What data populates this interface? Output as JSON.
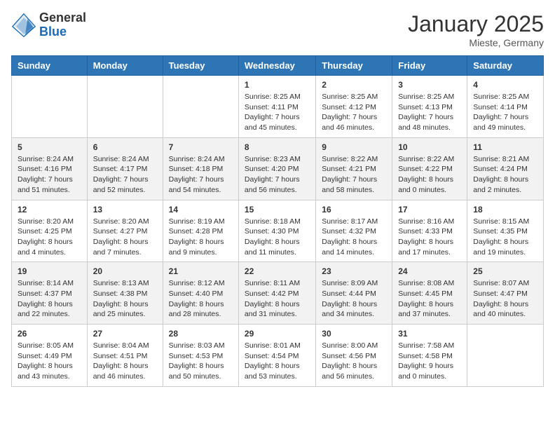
{
  "header": {
    "logo_general": "General",
    "logo_blue": "Blue",
    "month_title": "January 2025",
    "location": "Mieste, Germany"
  },
  "weekdays": [
    "Sunday",
    "Monday",
    "Tuesday",
    "Wednesday",
    "Thursday",
    "Friday",
    "Saturday"
  ],
  "weeks": [
    [
      {
        "day": "",
        "info": ""
      },
      {
        "day": "",
        "info": ""
      },
      {
        "day": "",
        "info": ""
      },
      {
        "day": "1",
        "info": "Sunrise: 8:25 AM\nSunset: 4:11 PM\nDaylight: 7 hours\nand 45 minutes."
      },
      {
        "day": "2",
        "info": "Sunrise: 8:25 AM\nSunset: 4:12 PM\nDaylight: 7 hours\nand 46 minutes."
      },
      {
        "day": "3",
        "info": "Sunrise: 8:25 AM\nSunset: 4:13 PM\nDaylight: 7 hours\nand 48 minutes."
      },
      {
        "day": "4",
        "info": "Sunrise: 8:25 AM\nSunset: 4:14 PM\nDaylight: 7 hours\nand 49 minutes."
      }
    ],
    [
      {
        "day": "5",
        "info": "Sunrise: 8:24 AM\nSunset: 4:16 PM\nDaylight: 7 hours\nand 51 minutes."
      },
      {
        "day": "6",
        "info": "Sunrise: 8:24 AM\nSunset: 4:17 PM\nDaylight: 7 hours\nand 52 minutes."
      },
      {
        "day": "7",
        "info": "Sunrise: 8:24 AM\nSunset: 4:18 PM\nDaylight: 7 hours\nand 54 minutes."
      },
      {
        "day": "8",
        "info": "Sunrise: 8:23 AM\nSunset: 4:20 PM\nDaylight: 7 hours\nand 56 minutes."
      },
      {
        "day": "9",
        "info": "Sunrise: 8:22 AM\nSunset: 4:21 PM\nDaylight: 7 hours\nand 58 minutes."
      },
      {
        "day": "10",
        "info": "Sunrise: 8:22 AM\nSunset: 4:22 PM\nDaylight: 8 hours\nand 0 minutes."
      },
      {
        "day": "11",
        "info": "Sunrise: 8:21 AM\nSunset: 4:24 PM\nDaylight: 8 hours\nand 2 minutes."
      }
    ],
    [
      {
        "day": "12",
        "info": "Sunrise: 8:20 AM\nSunset: 4:25 PM\nDaylight: 8 hours\nand 4 minutes."
      },
      {
        "day": "13",
        "info": "Sunrise: 8:20 AM\nSunset: 4:27 PM\nDaylight: 8 hours\nand 7 minutes."
      },
      {
        "day": "14",
        "info": "Sunrise: 8:19 AM\nSunset: 4:28 PM\nDaylight: 8 hours\nand 9 minutes."
      },
      {
        "day": "15",
        "info": "Sunrise: 8:18 AM\nSunset: 4:30 PM\nDaylight: 8 hours\nand 11 minutes."
      },
      {
        "day": "16",
        "info": "Sunrise: 8:17 AM\nSunset: 4:32 PM\nDaylight: 8 hours\nand 14 minutes."
      },
      {
        "day": "17",
        "info": "Sunrise: 8:16 AM\nSunset: 4:33 PM\nDaylight: 8 hours\nand 17 minutes."
      },
      {
        "day": "18",
        "info": "Sunrise: 8:15 AM\nSunset: 4:35 PM\nDaylight: 8 hours\nand 19 minutes."
      }
    ],
    [
      {
        "day": "19",
        "info": "Sunrise: 8:14 AM\nSunset: 4:37 PM\nDaylight: 8 hours\nand 22 minutes."
      },
      {
        "day": "20",
        "info": "Sunrise: 8:13 AM\nSunset: 4:38 PM\nDaylight: 8 hours\nand 25 minutes."
      },
      {
        "day": "21",
        "info": "Sunrise: 8:12 AM\nSunset: 4:40 PM\nDaylight: 8 hours\nand 28 minutes."
      },
      {
        "day": "22",
        "info": "Sunrise: 8:11 AM\nSunset: 4:42 PM\nDaylight: 8 hours\nand 31 minutes."
      },
      {
        "day": "23",
        "info": "Sunrise: 8:09 AM\nSunset: 4:44 PM\nDaylight: 8 hours\nand 34 minutes."
      },
      {
        "day": "24",
        "info": "Sunrise: 8:08 AM\nSunset: 4:45 PM\nDaylight: 8 hours\nand 37 minutes."
      },
      {
        "day": "25",
        "info": "Sunrise: 8:07 AM\nSunset: 4:47 PM\nDaylight: 8 hours\nand 40 minutes."
      }
    ],
    [
      {
        "day": "26",
        "info": "Sunrise: 8:05 AM\nSunset: 4:49 PM\nDaylight: 8 hours\nand 43 minutes."
      },
      {
        "day": "27",
        "info": "Sunrise: 8:04 AM\nSunset: 4:51 PM\nDaylight: 8 hours\nand 46 minutes."
      },
      {
        "day": "28",
        "info": "Sunrise: 8:03 AM\nSunset: 4:53 PM\nDaylight: 8 hours\nand 50 minutes."
      },
      {
        "day": "29",
        "info": "Sunrise: 8:01 AM\nSunset: 4:54 PM\nDaylight: 8 hours\nand 53 minutes."
      },
      {
        "day": "30",
        "info": "Sunrise: 8:00 AM\nSunset: 4:56 PM\nDaylight: 8 hours\nand 56 minutes."
      },
      {
        "day": "31",
        "info": "Sunrise: 7:58 AM\nSunset: 4:58 PM\nDaylight: 9 hours\nand 0 minutes."
      },
      {
        "day": "",
        "info": ""
      }
    ]
  ]
}
